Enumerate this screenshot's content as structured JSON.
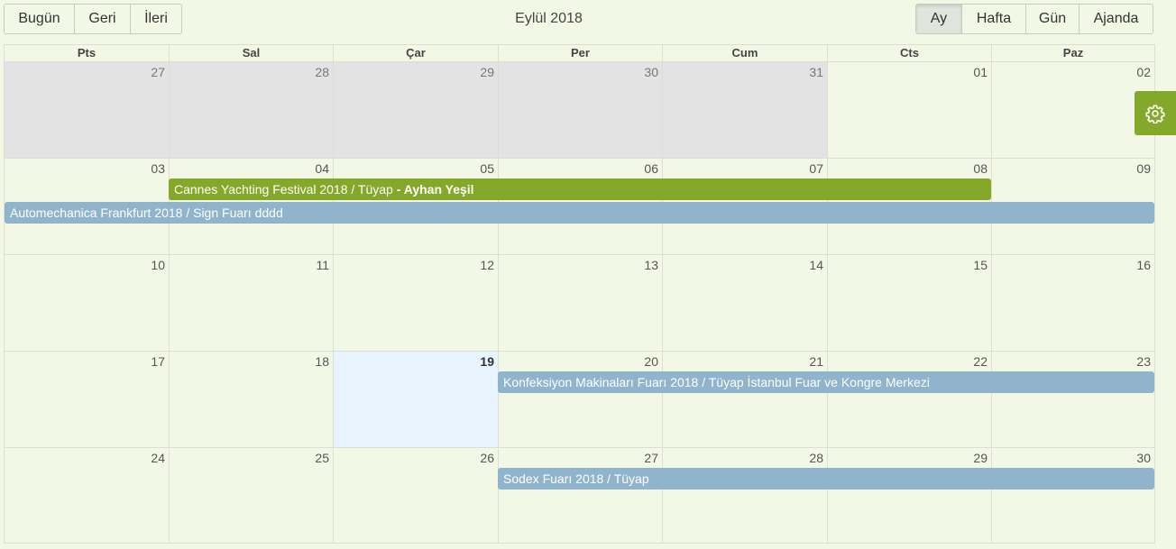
{
  "toolbar": {
    "today_label": "Bugün",
    "prev_label": "Geri",
    "next_label": "İleri",
    "title": "Eylül 2018",
    "views": [
      "Ay",
      "Hafta",
      "Gün",
      "Ajanda"
    ],
    "active_view": "Ay"
  },
  "weekdays": [
    "Pts",
    "Sal",
    "Çar",
    "Per",
    "Cum",
    "Cts",
    "Paz"
  ],
  "weeks": [
    [
      "27",
      "28",
      "29",
      "30",
      "31",
      "01",
      "02"
    ],
    [
      "03",
      "04",
      "05",
      "06",
      "07",
      "08",
      "09"
    ],
    [
      "10",
      "11",
      "12",
      "13",
      "14",
      "15",
      "16"
    ],
    [
      "17",
      "18",
      "19",
      "20",
      "21",
      "22",
      "23"
    ],
    [
      "24",
      "25",
      "26",
      "27",
      "28",
      "29",
      "30"
    ]
  ],
  "other_month_days": [
    "27",
    "28",
    "29",
    "30",
    "31"
  ],
  "today": "19",
  "events": {
    "cannes_title": "Cannes Yachting Festival 2018 / Tüyap",
    "cannes_person": " - Ayhan Yeşil",
    "automechanica": "Automechanica Frankfurt 2018 / Sign Fuarı dddd",
    "konfeksiyon": "Konfeksiyon Makinaları Fuarı 2018 / Tüyap İstanbul Fuar ve Kongre Merkezi",
    "sodex": "Sodex Fuarı 2018 / Tüyap"
  },
  "colors": {
    "accent_green": "#84a829",
    "event_blue": "#8fb4cc",
    "background": "#f3f8e6",
    "today_bg": "#e8f4ff",
    "other_month_bg": "#e3e3e3"
  },
  "icons": {
    "settings": "gear-icon"
  }
}
